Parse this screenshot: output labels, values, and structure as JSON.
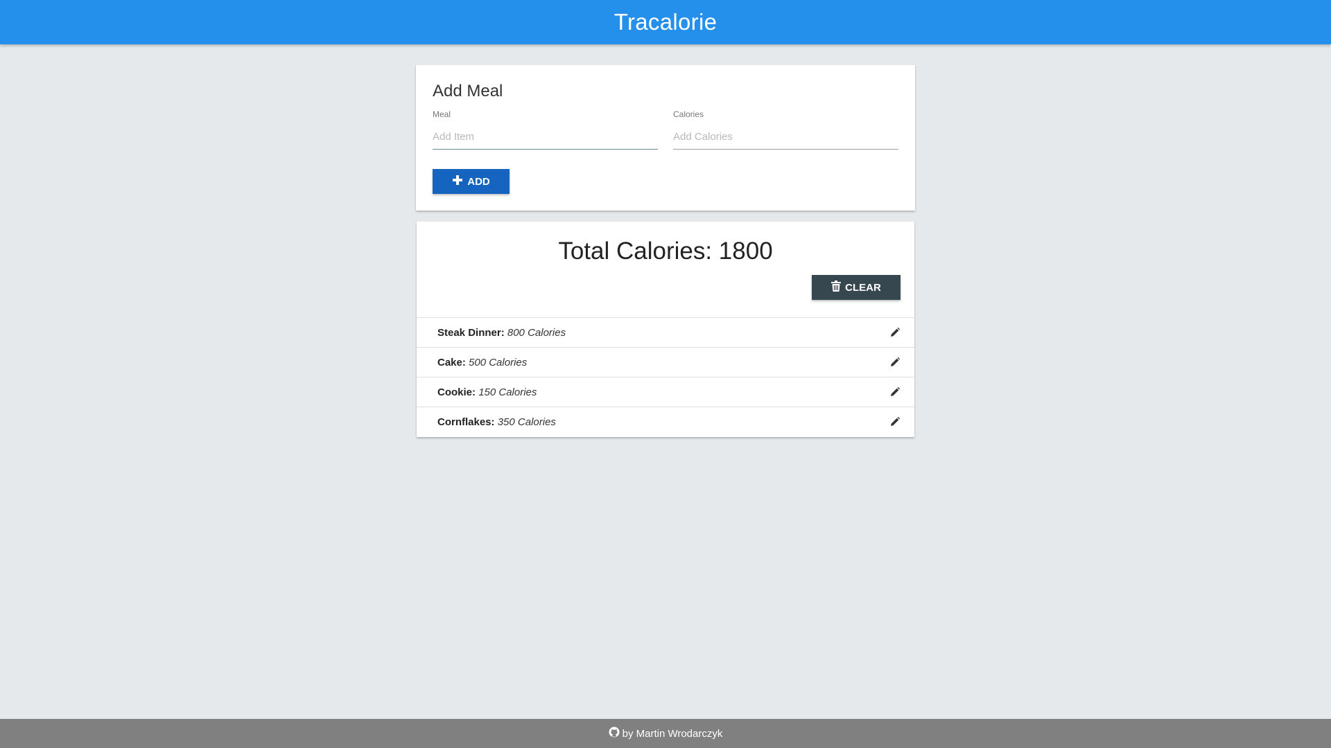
{
  "app": {
    "title": "Tracalorie"
  },
  "add_meal": {
    "title": "Add Meal",
    "meal_label": "Meal",
    "meal_placeholder": "Add Item",
    "meal_value": "",
    "calories_label": "Calories",
    "calories_placeholder": "Add Calories",
    "calories_value": "",
    "add_button": "ADD"
  },
  "totals": {
    "heading": "Total Calories: 1800",
    "clear_button": "CLEAR"
  },
  "meals": [
    {
      "name": "Steak Dinner:",
      "calories": "800 Calories"
    },
    {
      "name": "Cake:",
      "calories": "500 Calories"
    },
    {
      "name": "Cookie:",
      "calories": "150 Calories"
    },
    {
      "name": "Cornflakes:",
      "calories": "350 Calories"
    }
  ],
  "footer": {
    "text": "by Martin Wrodarczyk",
    "icon": "github-icon"
  },
  "colors": {
    "navbar": "#2490eb",
    "add_button": "#1565c0",
    "clear_button": "#37474f",
    "background": "#e5e9ec",
    "footer": "#808080"
  }
}
